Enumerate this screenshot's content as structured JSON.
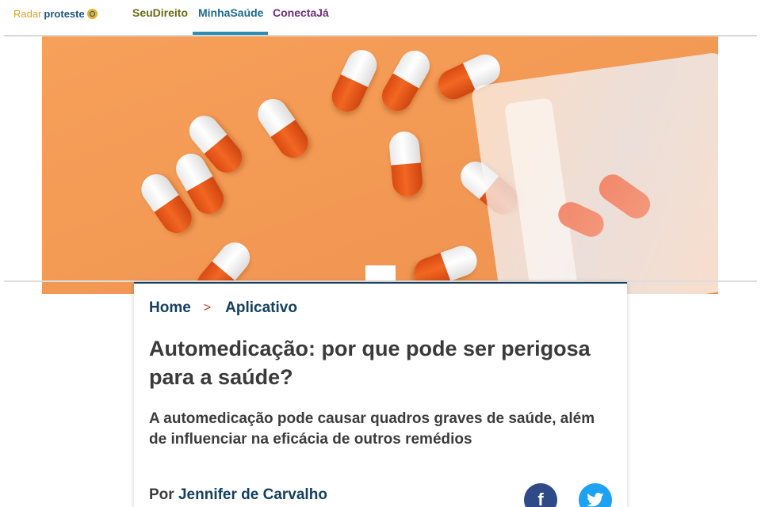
{
  "logo": {
    "radar": "Radar",
    "proteste": "proteste"
  },
  "nav": {
    "items": [
      {
        "label": "SeuDireito"
      },
      {
        "label": "MinhaSaúde",
        "active": true
      },
      {
        "label": "ConectaJá"
      }
    ]
  },
  "breadcrumb": {
    "home": "Home",
    "separator": ">",
    "section": "Aplicativo"
  },
  "article": {
    "title": "Automedicação: por que pode ser perigosa para a saúde?",
    "subtitle": "A automedicação pode causar quadros graves de saúde, além de influenciar na eficácia de outros remédios",
    "author_prefix": "Por",
    "author_name": "Jennifer de Carvalho"
  },
  "share": {
    "facebook_icon": "f",
    "twitter_icon": "🐦"
  },
  "colors": {
    "nav_active_underline": "#2a8fb3",
    "title_text": "#3a3a3a",
    "breadcrumb_text": "#15405f",
    "facebook": "#2f4a87",
    "twitter": "#1da1f2"
  }
}
